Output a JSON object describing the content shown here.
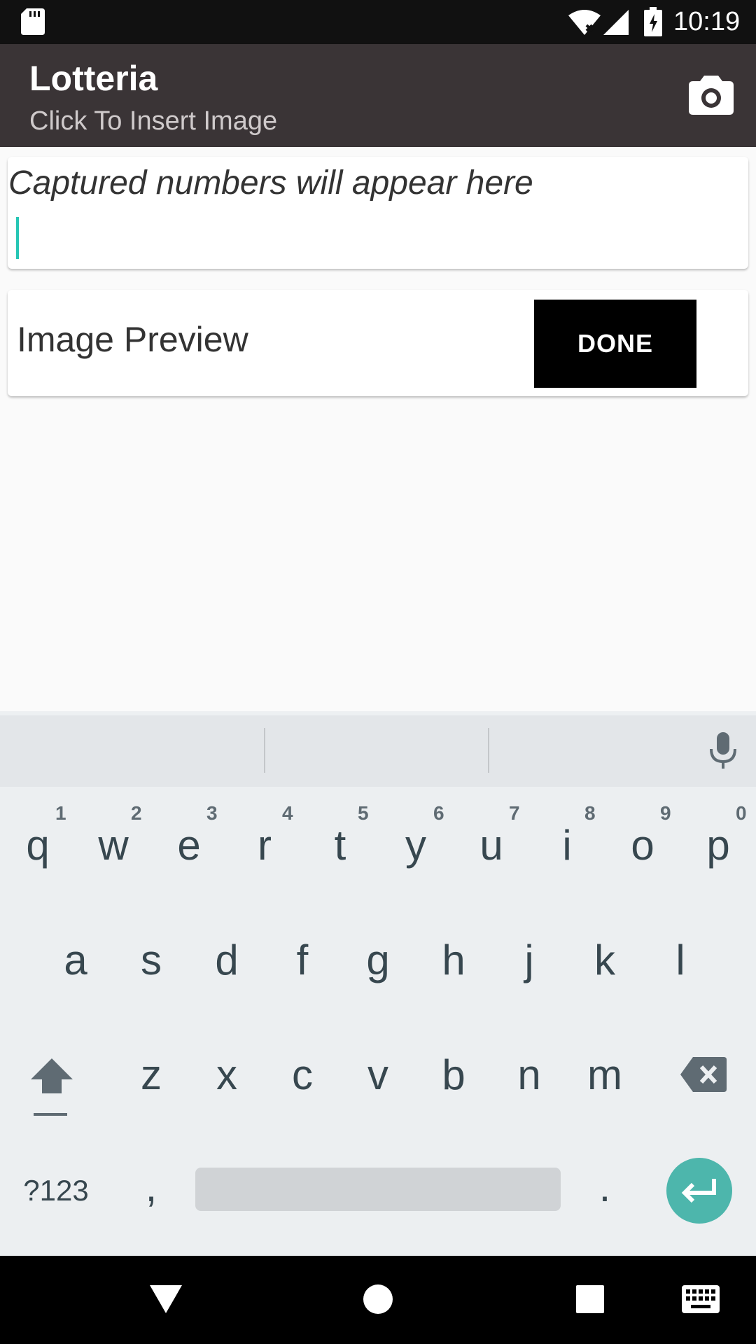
{
  "status_bar": {
    "time": "10:19",
    "icons": [
      "sd-card-icon",
      "wifi-icon",
      "signal-icon",
      "battery-charging-icon"
    ]
  },
  "app_bar": {
    "title": "Lotteria",
    "subtitle": "Click To Insert Image",
    "action_icon": "camera-icon"
  },
  "input_card": {
    "placeholder": "Captured numbers will appear here"
  },
  "preview_card": {
    "label": "Image Preview",
    "done_label": "DONE"
  },
  "keyboard": {
    "row1": [
      {
        "key": "q",
        "hint": "1"
      },
      {
        "key": "w",
        "hint": "2"
      },
      {
        "key": "e",
        "hint": "3"
      },
      {
        "key": "r",
        "hint": "4"
      },
      {
        "key": "t",
        "hint": "5"
      },
      {
        "key": "y",
        "hint": "6"
      },
      {
        "key": "u",
        "hint": "7"
      },
      {
        "key": "i",
        "hint": "8"
      },
      {
        "key": "o",
        "hint": "9"
      },
      {
        "key": "p",
        "hint": "0"
      }
    ],
    "row2": [
      "a",
      "s",
      "d",
      "f",
      "g",
      "h",
      "j",
      "k",
      "l"
    ],
    "row3": [
      "z",
      "x",
      "c",
      "v",
      "b",
      "n",
      "m"
    ],
    "symbols_label": "?123",
    "comma": ",",
    "period": "."
  },
  "nav_bar": {
    "icons": [
      "back-icon",
      "home-icon",
      "recents-icon",
      "keyboard-icon"
    ]
  },
  "colors": {
    "status_bar": "#111111",
    "app_bar": "#3a3436",
    "cursor": "#26c6b4",
    "enter": "#4db6ac"
  }
}
